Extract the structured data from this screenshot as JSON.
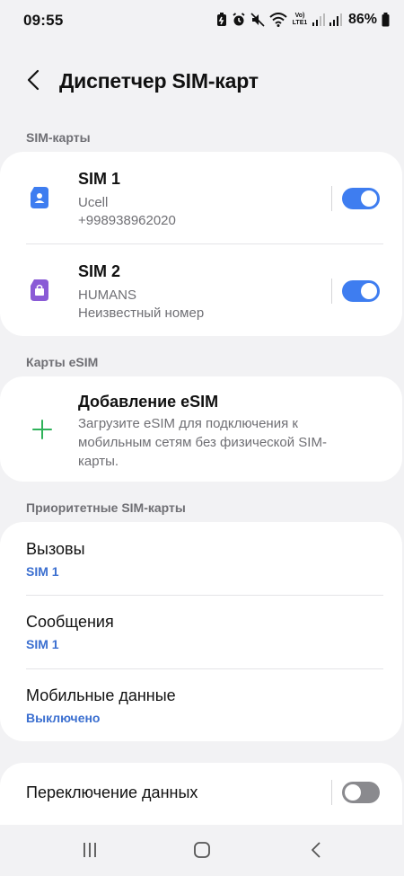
{
  "status_bar": {
    "time": "09:55",
    "battery_percent": "86%",
    "network_label": "Vo) LTE1",
    "icons": [
      "battery-saver-icon",
      "alarm-icon",
      "mute-icon",
      "wifi-icon",
      "volte-icon",
      "signal-sim1-icon",
      "signal-sim2-icon",
      "battery-icon"
    ]
  },
  "header": {
    "back_icon": "chevron-left-icon",
    "title": "Диспетчер SIM-карт"
  },
  "sections": {
    "sim_cards": "SIM-карты",
    "esim": "Карты eSIM",
    "priority": "Приоритетные SIM-карты"
  },
  "sims": [
    {
      "name": "SIM 1",
      "operator": "Ucell",
      "number": "+998938962020",
      "enabled": true,
      "icon": "sim-person-icon",
      "icon_color": "#3e7df0"
    },
    {
      "name": "SIM 2",
      "operator": "HUMANS",
      "number": "Неизвестный номер",
      "enabled": true,
      "icon": "sim-bag-icon",
      "icon_color": "#8a5bd6"
    }
  ],
  "esim": {
    "icon": "plus-icon",
    "icon_color": "#2fb25a",
    "title": "Добавление eSIM",
    "description": "Загрузите eSIM для подключения к мобильным сетям без физической SIM-карты."
  },
  "priority": [
    {
      "title": "Вызовы",
      "value": "SIM 1"
    },
    {
      "title": "Сообщения",
      "value": "SIM 1"
    },
    {
      "title": "Мобильные данные",
      "value": "Выключено"
    }
  ],
  "data_switch": {
    "title": "Переключение данных",
    "enabled": false
  },
  "nav": {
    "icons": [
      "recent-apps-icon",
      "home-icon",
      "back-icon"
    ]
  },
  "colors": {
    "accent": "#3e7df0",
    "value_blue": "#3b6fd0",
    "background": "#f2f2f4",
    "card": "#ffffff"
  }
}
